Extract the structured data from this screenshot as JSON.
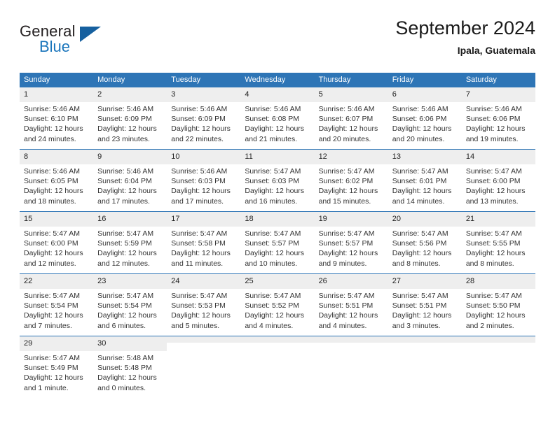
{
  "brand": {
    "name_top": "General",
    "name_bottom": "Blue"
  },
  "header": {
    "title": "September 2024",
    "subtitle": "Ipala, Guatemala"
  },
  "colors": {
    "header_blue": "#2e75b6",
    "daynum_gray": "#eeeeee",
    "logo_blue": "#1b76bc",
    "logo_dark": "#231f20"
  },
  "weekday_headers": [
    "Sunday",
    "Monday",
    "Tuesday",
    "Wednesday",
    "Thursday",
    "Friday",
    "Saturday"
  ],
  "labels": {
    "sunrise_prefix": "Sunrise:",
    "sunset_prefix": "Sunset:",
    "daylight_prefix": "Daylight:"
  },
  "weeks": [
    [
      {
        "day": "1",
        "sunrise": "Sunrise: 5:46 AM",
        "sunset": "Sunset: 6:10 PM",
        "daylight": "Daylight: 12 hours and 24 minutes."
      },
      {
        "day": "2",
        "sunrise": "Sunrise: 5:46 AM",
        "sunset": "Sunset: 6:09 PM",
        "daylight": "Daylight: 12 hours and 23 minutes."
      },
      {
        "day": "3",
        "sunrise": "Sunrise: 5:46 AM",
        "sunset": "Sunset: 6:09 PM",
        "daylight": "Daylight: 12 hours and 22 minutes."
      },
      {
        "day": "4",
        "sunrise": "Sunrise: 5:46 AM",
        "sunset": "Sunset: 6:08 PM",
        "daylight": "Daylight: 12 hours and 21 minutes."
      },
      {
        "day": "5",
        "sunrise": "Sunrise: 5:46 AM",
        "sunset": "Sunset: 6:07 PM",
        "daylight": "Daylight: 12 hours and 20 minutes."
      },
      {
        "day": "6",
        "sunrise": "Sunrise: 5:46 AM",
        "sunset": "Sunset: 6:06 PM",
        "daylight": "Daylight: 12 hours and 20 minutes."
      },
      {
        "day": "7",
        "sunrise": "Sunrise: 5:46 AM",
        "sunset": "Sunset: 6:06 PM",
        "daylight": "Daylight: 12 hours and 19 minutes."
      }
    ],
    [
      {
        "day": "8",
        "sunrise": "Sunrise: 5:46 AM",
        "sunset": "Sunset: 6:05 PM",
        "daylight": "Daylight: 12 hours and 18 minutes."
      },
      {
        "day": "9",
        "sunrise": "Sunrise: 5:46 AM",
        "sunset": "Sunset: 6:04 PM",
        "daylight": "Daylight: 12 hours and 17 minutes."
      },
      {
        "day": "10",
        "sunrise": "Sunrise: 5:46 AM",
        "sunset": "Sunset: 6:03 PM",
        "daylight": "Daylight: 12 hours and 17 minutes."
      },
      {
        "day": "11",
        "sunrise": "Sunrise: 5:47 AM",
        "sunset": "Sunset: 6:03 PM",
        "daylight": "Daylight: 12 hours and 16 minutes."
      },
      {
        "day": "12",
        "sunrise": "Sunrise: 5:47 AM",
        "sunset": "Sunset: 6:02 PM",
        "daylight": "Daylight: 12 hours and 15 minutes."
      },
      {
        "day": "13",
        "sunrise": "Sunrise: 5:47 AM",
        "sunset": "Sunset: 6:01 PM",
        "daylight": "Daylight: 12 hours and 14 minutes."
      },
      {
        "day": "14",
        "sunrise": "Sunrise: 5:47 AM",
        "sunset": "Sunset: 6:00 PM",
        "daylight": "Daylight: 12 hours and 13 minutes."
      }
    ],
    [
      {
        "day": "15",
        "sunrise": "Sunrise: 5:47 AM",
        "sunset": "Sunset: 6:00 PM",
        "daylight": "Daylight: 12 hours and 12 minutes."
      },
      {
        "day": "16",
        "sunrise": "Sunrise: 5:47 AM",
        "sunset": "Sunset: 5:59 PM",
        "daylight": "Daylight: 12 hours and 12 minutes."
      },
      {
        "day": "17",
        "sunrise": "Sunrise: 5:47 AM",
        "sunset": "Sunset: 5:58 PM",
        "daylight": "Daylight: 12 hours and 11 minutes."
      },
      {
        "day": "18",
        "sunrise": "Sunrise: 5:47 AM",
        "sunset": "Sunset: 5:57 PM",
        "daylight": "Daylight: 12 hours and 10 minutes."
      },
      {
        "day": "19",
        "sunrise": "Sunrise: 5:47 AM",
        "sunset": "Sunset: 5:57 PM",
        "daylight": "Daylight: 12 hours and 9 minutes."
      },
      {
        "day": "20",
        "sunrise": "Sunrise: 5:47 AM",
        "sunset": "Sunset: 5:56 PM",
        "daylight": "Daylight: 12 hours and 8 minutes."
      },
      {
        "day": "21",
        "sunrise": "Sunrise: 5:47 AM",
        "sunset": "Sunset: 5:55 PM",
        "daylight": "Daylight: 12 hours and 8 minutes."
      }
    ],
    [
      {
        "day": "22",
        "sunrise": "Sunrise: 5:47 AM",
        "sunset": "Sunset: 5:54 PM",
        "daylight": "Daylight: 12 hours and 7 minutes."
      },
      {
        "day": "23",
        "sunrise": "Sunrise: 5:47 AM",
        "sunset": "Sunset: 5:54 PM",
        "daylight": "Daylight: 12 hours and 6 minutes."
      },
      {
        "day": "24",
        "sunrise": "Sunrise: 5:47 AM",
        "sunset": "Sunset: 5:53 PM",
        "daylight": "Daylight: 12 hours and 5 minutes."
      },
      {
        "day": "25",
        "sunrise": "Sunrise: 5:47 AM",
        "sunset": "Sunset: 5:52 PM",
        "daylight": "Daylight: 12 hours and 4 minutes."
      },
      {
        "day": "26",
        "sunrise": "Sunrise: 5:47 AM",
        "sunset": "Sunset: 5:51 PM",
        "daylight": "Daylight: 12 hours and 4 minutes."
      },
      {
        "day": "27",
        "sunrise": "Sunrise: 5:47 AM",
        "sunset": "Sunset: 5:51 PM",
        "daylight": "Daylight: 12 hours and 3 minutes."
      },
      {
        "day": "28",
        "sunrise": "Sunrise: 5:47 AM",
        "sunset": "Sunset: 5:50 PM",
        "daylight": "Daylight: 12 hours and 2 minutes."
      }
    ],
    [
      {
        "day": "29",
        "sunrise": "Sunrise: 5:47 AM",
        "sunset": "Sunset: 5:49 PM",
        "daylight": "Daylight: 12 hours and 1 minute."
      },
      {
        "day": "30",
        "sunrise": "Sunrise: 5:48 AM",
        "sunset": "Sunset: 5:48 PM",
        "daylight": "Daylight: 12 hours and 0 minutes."
      },
      {
        "day": "",
        "sunrise": "",
        "sunset": "",
        "daylight": ""
      },
      {
        "day": "",
        "sunrise": "",
        "sunset": "",
        "daylight": ""
      },
      {
        "day": "",
        "sunrise": "",
        "sunset": "",
        "daylight": ""
      },
      {
        "day": "",
        "sunrise": "",
        "sunset": "",
        "daylight": ""
      },
      {
        "day": "",
        "sunrise": "",
        "sunset": "",
        "daylight": ""
      }
    ]
  ]
}
